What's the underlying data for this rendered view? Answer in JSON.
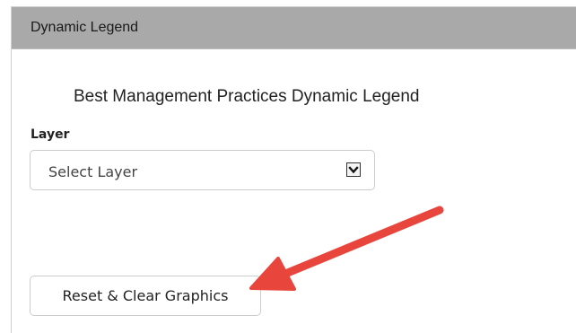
{
  "panel": {
    "title": "Dynamic Legend"
  },
  "legend": {
    "heading": "Best Management Practices Dynamic Legend",
    "layer_label": "Layer",
    "layer_select": {
      "selected": "Select Layer",
      "arrow_icon": "chevron-down-icon"
    },
    "reset_button_label": "Reset & Clear Graphics"
  },
  "annotation": {
    "arrow_color": "#e8453c",
    "arrow_icon": "callout-arrow"
  },
  "colors": {
    "header_bg": "#a9a9a9",
    "border": "#cccccc"
  }
}
